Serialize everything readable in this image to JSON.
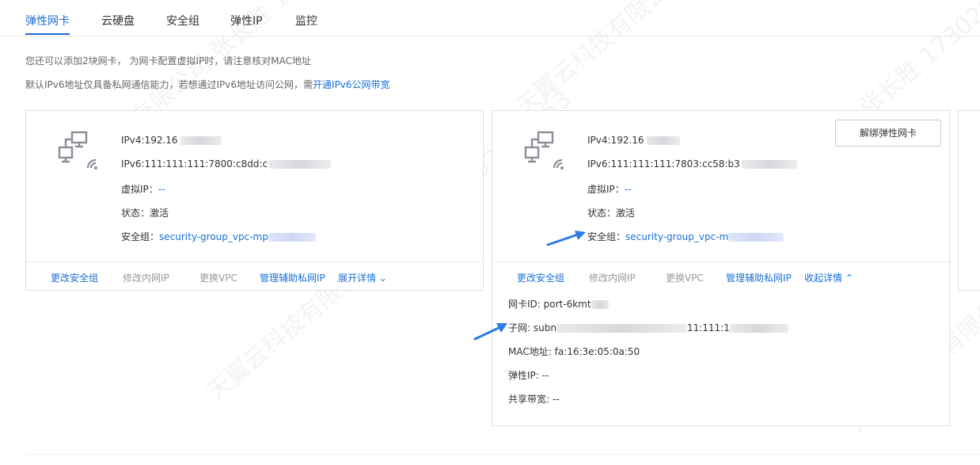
{
  "tabs": [
    {
      "label": "弹性网卡",
      "active": true
    },
    {
      "label": "云硬盘"
    },
    {
      "label": "安全组"
    },
    {
      "label": "弹性IP"
    },
    {
      "label": "监控"
    }
  ],
  "notices": {
    "line1": "您还可以添加2块网卡， 为网卡配置虚拟IP时，请注意核对MAC地址",
    "line2_prefix": "默认IPv6地址仅具备私网通信能力，若想通过IPv6地址访问公网，需",
    "line2_link": "开通IPv6公网带宽"
  },
  "cards": [
    {
      "ipv4": "IPv4:192.16",
      "ipv6": "IPv6:111:111:111:7800:c8dd:c",
      "virtual_ip_label": "虚拟IP：",
      "virtual_ip_value": "--",
      "status_label": "状态：",
      "status_value": "激活",
      "sg_label": "安全组：",
      "sg_value": "security-group_vpc-mp",
      "actions": {
        "change_sg": "更改安全组",
        "modify_ip": "修改内网IP",
        "change_vpc": "更换VPC",
        "manage_ip": "管理辅助私网IP",
        "toggle": "展开详情 ⌄"
      }
    },
    {
      "ipv4": "IPv4:192.16",
      "ipv6": "IPv6:111:111:111:7803:cc58:b3",
      "virtual_ip_label": "虚拟IP：",
      "virtual_ip_value": "--",
      "status_label": "状态：",
      "status_value": "激活",
      "sg_label": "安全组：",
      "sg_value": "security-group_vpc-m",
      "unbind_button": "解绑弹性网卡",
      "actions": {
        "change_sg": "更改安全组",
        "modify_ip": "修改内网IP",
        "change_vpc": "更换VPC",
        "manage_ip": "管理辅助私网IP",
        "toggle": "收起详情 ⌃"
      },
      "details": {
        "nic_id": "网卡ID: port-6kmt",
        "subnet_prefix": "子网: subn",
        "subnet_mid": "11:111:1",
        "mac": "MAC地址: fa:16:3e:05:0a:50",
        "eip": "弹性IP: --",
        "bandwidth": "共享带宽: --"
      }
    }
  ],
  "watermark": "天翼云科技有限公司 张长胜 17302025153",
  "colors": {
    "accent": "#1a6fd8",
    "border": "#dcdfe6",
    "arrow": "#2b7be6"
  }
}
